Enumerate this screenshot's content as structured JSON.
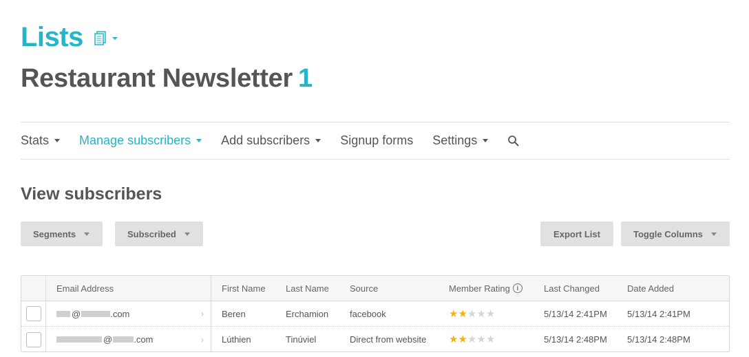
{
  "header": {
    "title": "Lists",
    "list_name": "Restaurant Newsletter",
    "list_count": "1"
  },
  "nav": {
    "items": [
      {
        "label": "Stats",
        "dropdown": true,
        "active": false
      },
      {
        "label": "Manage subscribers",
        "dropdown": true,
        "active": true
      },
      {
        "label": "Add subscribers",
        "dropdown": true,
        "active": false
      },
      {
        "label": "Signup forms",
        "dropdown": false,
        "active": false
      },
      {
        "label": "Settings",
        "dropdown": true,
        "active": false
      }
    ]
  },
  "section": {
    "title": "View subscribers"
  },
  "toolbar": {
    "segments_label": "Segments",
    "subscribed_label": "Subscribed",
    "export_label": "Export List",
    "toggle_label": "Toggle Columns"
  },
  "table": {
    "columns": {
      "email": "Email Address",
      "first": "First Name",
      "last": "Last Name",
      "source": "Source",
      "rating": "Member Rating",
      "changed": "Last Changed",
      "added": "Date Added"
    },
    "rows": [
      {
        "email_visible": "@",
        "email_domain": ".com",
        "first": "Beren",
        "last": "Erchamion",
        "source": "facebook",
        "rating": 2,
        "rating_max": 5,
        "changed": "5/13/14 2:41PM",
        "added": "5/13/14 2:41PM"
      },
      {
        "email_visible": "@",
        "email_domain": ".com",
        "first": "Lúthien",
        "last": "Tinúviel",
        "source": "Direct from website",
        "rating": 2,
        "rating_max": 5,
        "changed": "5/13/14 2:48PM",
        "added": "5/13/14 2:48PM"
      }
    ]
  },
  "colors": {
    "accent": "#25b4c8",
    "text": "#555555",
    "star_on": "#f2b20f",
    "star_off": "#d5d5d5",
    "button_bg": "#e1e1e1"
  }
}
